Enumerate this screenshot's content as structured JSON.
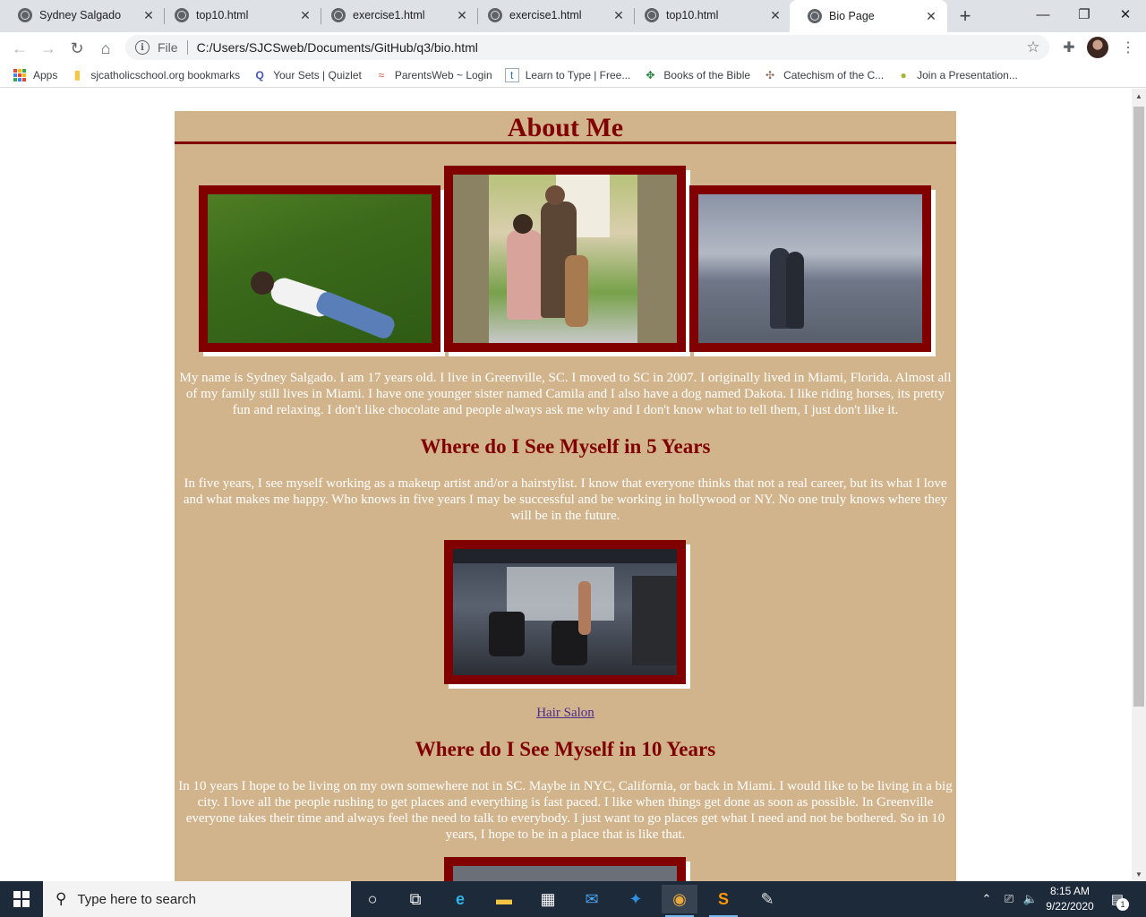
{
  "browser": {
    "tabs": [
      {
        "title": "Sydney Salgado",
        "close": "✕"
      },
      {
        "title": "top10.html",
        "close": "✕"
      },
      {
        "title": "exercise1.html",
        "close": "✕"
      },
      {
        "title": "exercise1.html",
        "close": "✕"
      },
      {
        "title": "top10.html",
        "close": "✕"
      },
      {
        "title": "Bio Page",
        "close": "✕"
      }
    ],
    "active_tab_index": 5,
    "new_tab": "+",
    "window_controls": {
      "minimize": "—",
      "restore": "❐",
      "close": "✕"
    },
    "toolbar": {
      "back": "←",
      "forward": "→",
      "reload": "↻",
      "home": "⌂"
    },
    "omnibox": {
      "info": "i",
      "scheme_label": "File",
      "url": "C:/Users/SJCSweb/Documents/GitHub/q3/bio.html",
      "bookmark_star": "☆"
    },
    "extensions": "✚",
    "menu": "⋮"
  },
  "bookmarks": [
    {
      "label": "Apps",
      "icon": "apps-grid-icon"
    },
    {
      "label": "sjcatholicschool.org bookmarks",
      "icon": "folder-icon",
      "glyph": "▮"
    },
    {
      "label": "Your Sets | Quizlet",
      "icon": "quizlet-icon",
      "glyph": "Q"
    },
    {
      "label": "ParentsWeb ~ Login",
      "icon": "parentsweb-icon",
      "glyph": "≈"
    },
    {
      "label": "Learn to Type | Free...",
      "icon": "typing-icon",
      "glyph": "t"
    },
    {
      "label": "Books of the Bible",
      "icon": "globe-icon",
      "glyph": "✥"
    },
    {
      "label": "Catechism of the C...",
      "icon": "catechism-icon",
      "glyph": "✣"
    },
    {
      "label": "Join a Presentation...",
      "icon": "pear-icon",
      "glyph": "●"
    }
  ],
  "colors": {
    "page_background": "#d2b48c",
    "heading": "#800000",
    "frame": "#800000",
    "body_text": "#ffffff",
    "link": "#4b2c8c"
  },
  "page": {
    "title": "About Me",
    "intro": "My name is Sydney Salgado. I am 17 years old. I live in Greenville, SC. I moved to SC in 2007. I originally lived in Miami, Florida. Almost all of my family still lives in Miami. I have one younger sister named Camila and I also have a dog named Dakota. I like riding horses, its pretty fun and relaxing. I don't like chocolate and people always ask me why and I don't know what to tell them, I just don't like it.",
    "section_5": {
      "title": "Where do I See Myself in 5 Years",
      "text": "In five years, I see myself working as a makeup artist and/or a hairstylist. I know that everyone thinks that not a real career, but its what I love and what makes me happy. Who knows in five years I may be successful and be working in hollywood or NY. No one truly knows where they will be in the future.",
      "image_caption_link": "Hair Salon"
    },
    "section_10": {
      "title": "Where do I See Myself in 10 Years",
      "text": "In 10 years I hope to be living on my own somewhere not in SC. Maybe in NYC, California, or back in Miami. I would like to be living in a big city. I love all the people rushing to get places and everything is fast paced. I like when things get done as soon as possible. In Greenville everyone takes their time and always feel the need to talk to everybody. I just want to go places get what I need and not be bothered. So in 10 years, I hope to be in a place that is like that."
    }
  },
  "scrollbar": {
    "up": "▲",
    "down": "▼"
  },
  "taskbar": {
    "search_placeholder": "Type here to search",
    "search_glyph": "⚲",
    "cortana_glyph": "○",
    "taskview_glyph": "⧉",
    "apps": [
      {
        "name": "edge-icon",
        "glyph": "e",
        "color": "#2fb4e9"
      },
      {
        "name": "file-explorer-icon",
        "glyph": "▬",
        "color": "#f4c542"
      },
      {
        "name": "store-icon",
        "glyph": "▦",
        "color": "#ffffff"
      },
      {
        "name": "mail-icon",
        "glyph": "✉",
        "color": "#4aa3f0"
      },
      {
        "name": "safari-icon",
        "glyph": "✦",
        "color": "#2f8fe0"
      },
      {
        "name": "chrome-icon",
        "glyph": "◉",
        "color": "#e9a93b"
      },
      {
        "name": "sublime-icon",
        "glyph": "S",
        "color": "#ff9800"
      },
      {
        "name": "paint-icon",
        "glyph": "✎",
        "color": "#e0e0e0"
      }
    ],
    "tray": {
      "chevron": "⌃",
      "network": "⎚",
      "volume": "🔈"
    },
    "time": "8:15 AM",
    "date": "9/22/2020",
    "notifications_glyph": "▤",
    "notifications_count": "1"
  }
}
